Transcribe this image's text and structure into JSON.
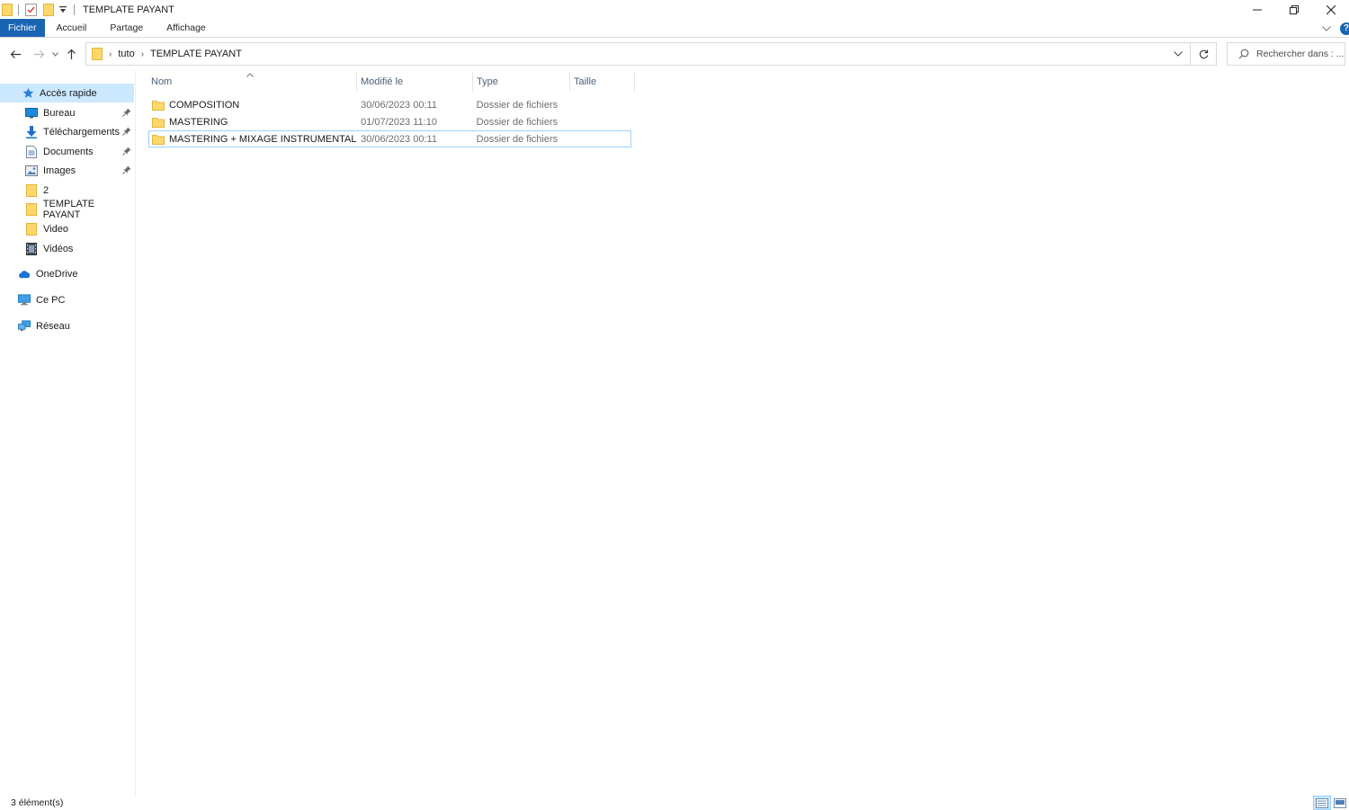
{
  "window": {
    "title": "TEMPLATE PAYANT"
  },
  "ribbon": {
    "tabs": [
      {
        "label": "Fichier",
        "active": true
      },
      {
        "label": "Accueil"
      },
      {
        "label": "Partage"
      },
      {
        "label": "Affichage"
      }
    ],
    "help_label": "?"
  },
  "address": {
    "path": [
      "tuto",
      "TEMPLATE PAYANT"
    ]
  },
  "search": {
    "placeholder": "Rechercher dans : ..."
  },
  "sidebar": {
    "quick_access": "Accès rapide",
    "pinned": [
      {
        "label": "Bureau",
        "icon": "desktop-icon",
        "pinned": true
      },
      {
        "label": "Téléchargements",
        "icon": "download-icon",
        "pinned": true
      },
      {
        "label": "Documents",
        "icon": "documents-icon",
        "pinned": true
      },
      {
        "label": "Images",
        "icon": "images-icon",
        "pinned": true
      },
      {
        "label": "2",
        "icon": "folder-icon",
        "pinned": false
      },
      {
        "label": "TEMPLATE PAYANT",
        "icon": "folder-icon",
        "pinned": false
      },
      {
        "label": "Video",
        "icon": "folder-icon",
        "pinned": false
      },
      {
        "label": "Vidéos",
        "icon": "videos-icon",
        "pinned": false
      }
    ],
    "onedrive": "OneDrive",
    "this_pc": "Ce PC",
    "network": "Réseau"
  },
  "columns": {
    "name": "Nom",
    "modified": "Modifié le",
    "type": "Type",
    "size": "Taille"
  },
  "files": [
    {
      "name": "COMPOSITION",
      "modified": "30/06/2023 00:11",
      "type": "Dossier de fichiers",
      "size": ""
    },
    {
      "name": "MASTERING",
      "modified": "01/07/2023 11:10",
      "type": "Dossier de fichiers",
      "size": ""
    },
    {
      "name": "MASTERING + MIXAGE INSTRUMENTAL ...",
      "modified": "30/06/2023 00:11",
      "type": "Dossier de fichiers",
      "size": "",
      "focused": true
    }
  ],
  "status": {
    "count_text": "3 élément(s)"
  },
  "colors": {
    "accent": "#1a64b4",
    "selection": "#cce8ff",
    "focus_border": "#99d1ff",
    "folder": "#ffd86b"
  }
}
